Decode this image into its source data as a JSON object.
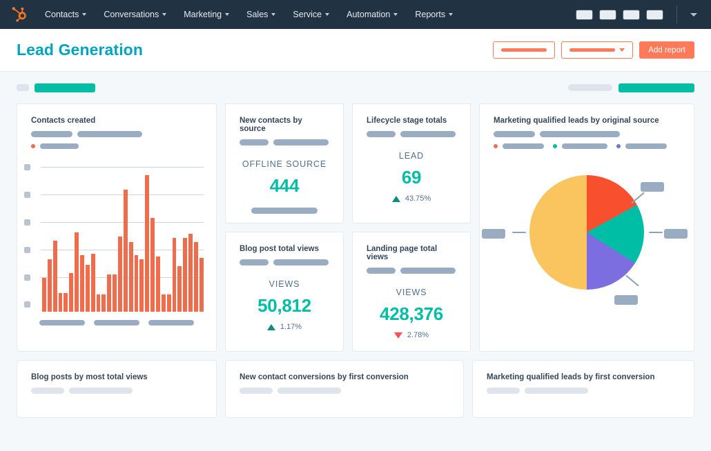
{
  "nav": {
    "logo_icon": "hubspot-sprocket-logo",
    "items": [
      {
        "label": "Contacts",
        "has_caret": true
      },
      {
        "label": "Conversations",
        "has_caret": true
      },
      {
        "label": "Marketing",
        "has_caret": true
      },
      {
        "label": "Sales",
        "has_caret": true
      },
      {
        "label": "Service",
        "has_caret": true
      },
      {
        "label": "Automation",
        "has_caret": true
      },
      {
        "label": "Reports",
        "has_caret": true
      }
    ],
    "right_chips": 4,
    "chevron_icon": "chevron-down-icon"
  },
  "header": {
    "title": "Lead Generation",
    "title_color": "#00a4bd",
    "actions": {
      "outline_button_1_label": "",
      "outline_button_2_label": "",
      "outline_button_2_caret": "chevron-down-icon",
      "add_report_label": "Add report"
    }
  },
  "filter_bar": {
    "left_chip": "",
    "left_bar": "",
    "right_bar_grey": "",
    "right_bar_teal": ""
  },
  "colors": {
    "teal": "#00bda5",
    "teal_dark": "#0e8c7d",
    "orange": "#ff7a59",
    "bar_orange": "#ef6c4d",
    "red": "#f2545b",
    "navy": "#213343",
    "slate": "#33475b",
    "muted": "#516f90",
    "redaction": "#99acc2",
    "page_bg": "#f5f8fa"
  },
  "cards": {
    "contacts_created": {
      "title": "Contacts created",
      "subtitle_bars": 2,
      "legend": {
        "dot_color": "#ef6c4d",
        "label": ""
      },
      "y_tick_count": 6,
      "x_label_bars": 3
    },
    "new_contacts_by_source": {
      "title": "New contacts by source",
      "metric_label": "OFFLINE SOURCE",
      "metric_value": "444",
      "footer_bar": true
    },
    "lifecycle_stage_totals": {
      "title": "Lifecycle stage totals",
      "metric_label": "LEAD",
      "metric_value": "69",
      "delta_direction": "up",
      "delta_value": "43.75%"
    },
    "blog_post_total_views": {
      "title": "Blog post total views",
      "metric_label": "VIEWS",
      "metric_value": "50,812",
      "delta_direction": "up",
      "delta_value": "1.17%"
    },
    "landing_page_total_views": {
      "title": "Landing page total views",
      "metric_label": "VIEWS",
      "metric_value": "428,376",
      "delta_direction": "down",
      "delta_value": "2.78%"
    },
    "mql_by_original_source": {
      "title": "Marketing qualified leads by original source",
      "legend_dots": [
        "#ef6c4d",
        "#00bda5",
        "#6a78d1"
      ]
    },
    "blog_posts_by_most_total_views": {
      "title": "Blog posts by most total views"
    },
    "new_contact_conversions": {
      "title": "New contact conversions by first conversion"
    },
    "mql_by_first_conversion": {
      "title": "Marketing qualified leads by first conversion"
    }
  },
  "chart_data": [
    {
      "type": "bar",
      "title": "Contacts created",
      "xlabel": "",
      "ylabel": "",
      "ylim": [
        0,
        100
      ],
      "grid": true,
      "legend_position": "top-left",
      "series": [
        {
          "name": "Contacts created",
          "color": "#ef6c4d",
          "values": [
            24,
            37,
            50,
            13,
            13,
            27,
            56,
            40,
            33,
            41,
            12,
            12,
            26,
            26,
            53,
            86,
            49,
            40,
            37,
            96,
            66,
            39,
            12,
            12,
            52,
            32,
            52,
            55,
            49,
            38
          ]
        }
      ]
    },
    {
      "type": "pie",
      "title": "Marketing qualified leads by original source",
      "legend_position": "top",
      "labels": [
        "",
        "",
        "",
        ""
      ],
      "values": [
        50,
        17,
        17,
        16
      ],
      "colors": [
        "#fac45f",
        "#f8502e",
        "#00bda5",
        "#7c6ee0"
      ]
    }
  ]
}
